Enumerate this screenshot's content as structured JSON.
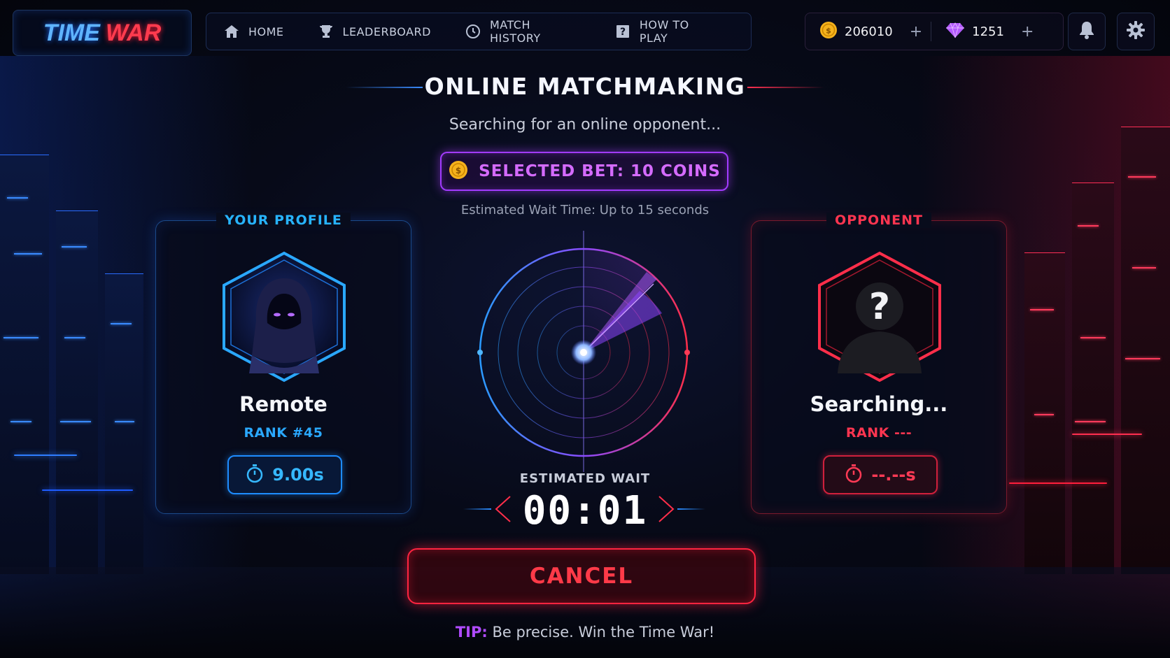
{
  "logo": {
    "part1": "TIME",
    "part2": "WAR"
  },
  "nav": [
    {
      "label": "HOME",
      "icon": "home-icon"
    },
    {
      "label": "LEADERBOARD",
      "icon": "trophy-icon"
    },
    {
      "label": "MATCH HISTORY",
      "icon": "history-clock-icon"
    },
    {
      "label": "HOW TO PLAY",
      "icon": "help-icon"
    }
  ],
  "currency": {
    "coins": "206010",
    "gems": "1251",
    "plus": "+"
  },
  "header": {
    "title": "ONLINE MATCHMAKING",
    "subtitle": "Searching for an online opponent...",
    "bet": "SELECTED BET: 10 COINS",
    "wait_note": "Estimated Wait Time: Up to 15 seconds"
  },
  "player": {
    "card_title": "YOUR PROFILE",
    "name": "Remote",
    "rank": "RANK #45",
    "time": "9.00s"
  },
  "opponent": {
    "card_title": "OPPONENT",
    "name": "Searching...",
    "rank": "RANK ---",
    "time": "--.--s",
    "placeholder": "?"
  },
  "estimate": {
    "label": "ESTIMATED WAIT",
    "value": "00:01"
  },
  "cancel_label": "CANCEL",
  "tip": {
    "key": "TIP:",
    "text": " Be precise. Win the Time War!"
  },
  "colors": {
    "player_accent": "#27b4ff",
    "opponent_accent": "#ff3550",
    "bet_accent": "#d56bff",
    "coin": "#f5b21c",
    "gem": "#b45bff"
  }
}
